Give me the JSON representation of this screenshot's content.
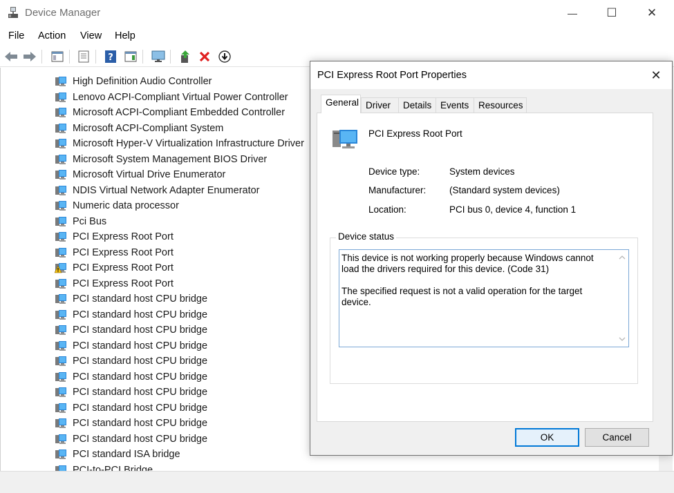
{
  "window": {
    "title": "Device Manager",
    "minimize": "—",
    "maximize": "☐",
    "close": "✕"
  },
  "menu": [
    "File",
    "Action",
    "View",
    "Help"
  ],
  "tree": {
    "items": [
      {
        "label": "High Definition Audio Controller",
        "warning": false
      },
      {
        "label": "Lenovo ACPI-Compliant Virtual Power Controller",
        "warning": false
      },
      {
        "label": "Microsoft ACPI-Compliant Embedded Controller",
        "warning": false
      },
      {
        "label": "Microsoft ACPI-Compliant System",
        "warning": false
      },
      {
        "label": "Microsoft Hyper-V Virtualization Infrastructure Driver",
        "warning": false
      },
      {
        "label": "Microsoft System Management BIOS Driver",
        "warning": false
      },
      {
        "label": "Microsoft Virtual Drive Enumerator",
        "warning": false
      },
      {
        "label": "NDIS Virtual Network Adapter Enumerator",
        "warning": false
      },
      {
        "label": "Numeric data processor",
        "warning": false
      },
      {
        "label": "Pci Bus",
        "warning": false
      },
      {
        "label": "PCI Express Root Port",
        "warning": false
      },
      {
        "label": "PCI Express Root Port",
        "warning": false
      },
      {
        "label": "PCI Express Root Port",
        "warning": true
      },
      {
        "label": "PCI Express Root Port",
        "warning": false
      },
      {
        "label": "PCI standard host CPU bridge",
        "warning": false
      },
      {
        "label": "PCI standard host CPU bridge",
        "warning": false
      },
      {
        "label": "PCI standard host CPU bridge",
        "warning": false
      },
      {
        "label": "PCI standard host CPU bridge",
        "warning": false
      },
      {
        "label": "PCI standard host CPU bridge",
        "warning": false
      },
      {
        "label": "PCI standard host CPU bridge",
        "warning": false
      },
      {
        "label": "PCI standard host CPU bridge",
        "warning": false
      },
      {
        "label": "PCI standard host CPU bridge",
        "warning": false
      },
      {
        "label": "PCI standard host CPU bridge",
        "warning": false
      },
      {
        "label": "PCI standard host CPU bridge",
        "warning": false
      },
      {
        "label": "PCI standard ISA bridge",
        "warning": false
      },
      {
        "label": "PCI-to-PCI Bridge",
        "warning": false
      }
    ]
  },
  "dialog": {
    "title": "PCI Express Root Port Properties",
    "close": "✕",
    "tabs": [
      "General",
      "Driver",
      "Details",
      "Events",
      "Resources"
    ],
    "device_name": "PCI Express Root Port",
    "props": {
      "type_label": "Device type:",
      "type_value": "System devices",
      "manufacturer_label": "Manufacturer:",
      "manufacturer_value": "(Standard system devices)",
      "location_label": "Location:",
      "location_value": "PCI bus 0, device 4, function 1"
    },
    "status_legend": "Device status",
    "status_text": "This device is not working properly because Windows cannot load the drivers required for this device. (Code 31)\n\nThe specified request is not a valid operation for the target device.",
    "ok": "OK",
    "cancel": "Cancel"
  },
  "colors": {
    "accent": "#0078d7",
    "warning": "#f5c211"
  }
}
